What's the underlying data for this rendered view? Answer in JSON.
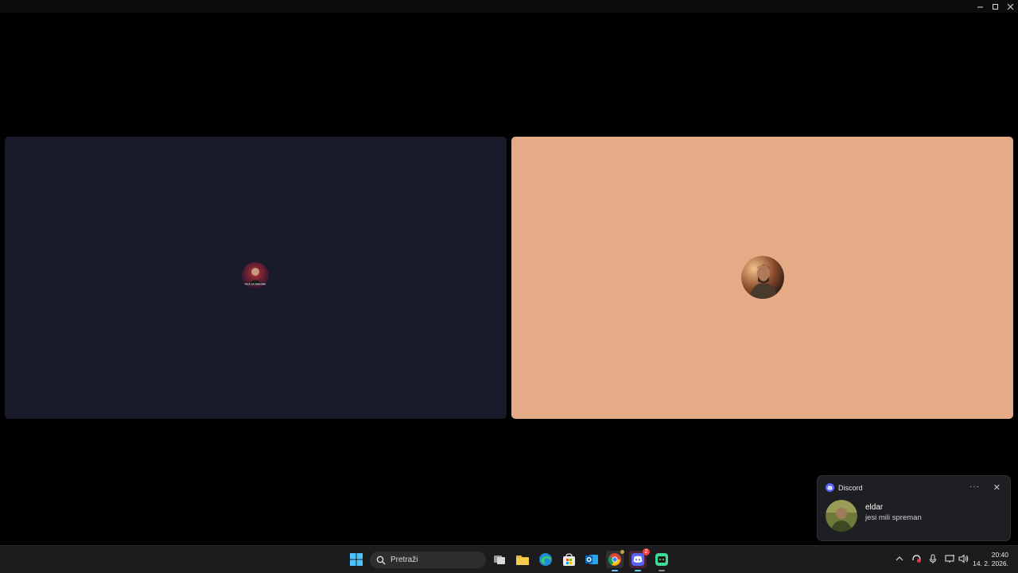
{
  "window": {
    "controls": {
      "minimize": "—",
      "maximize": "☐",
      "close": "✕"
    }
  },
  "call": {
    "participants": [
      {
        "tile_color": "#1a1b2a",
        "avatar_caption": "PRICE SA DISKORDA",
        "avatar_icon": "streamer-avatar"
      },
      {
        "tile_color": "#e5aa86",
        "avatar_icon": "warrior-avatar"
      }
    ]
  },
  "notification": {
    "app_name": "Discord",
    "more_label": "···",
    "close_label": "✕",
    "sender": "eldar",
    "message": "jesi mili spreman"
  },
  "taskbar": {
    "search_placeholder": "Pretraži",
    "apps": [
      "start",
      "search",
      "task-view",
      "file-explorer",
      "edge",
      "store",
      "outlook",
      "chrome",
      "discord",
      "discord-green"
    ],
    "chrome_badge": "",
    "discord_badge": "2"
  },
  "tray": {
    "time": "20:40",
    "date": "14. 2. 2026."
  }
}
